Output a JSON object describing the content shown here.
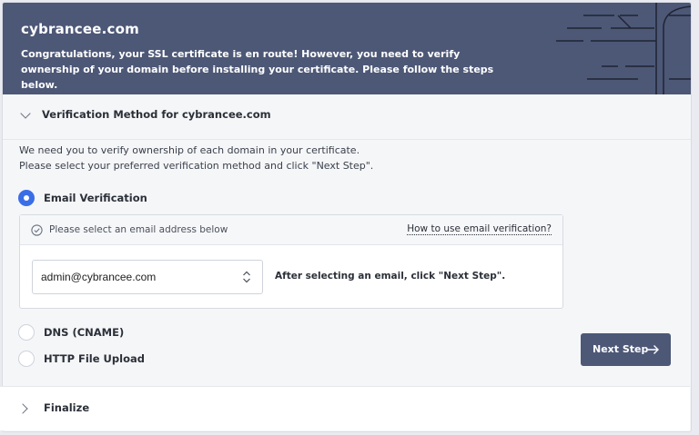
{
  "header": {
    "domain": "cybrancee.com",
    "message": "Congratulations, your SSL certificate is en route! However, you need to verify ownership of your domain before installing your certificate. Please follow the steps below."
  },
  "verification": {
    "section_title": "Verification Method for cybrancee.com",
    "intro_line1": "We need you to verify ownership of each domain in your certificate.",
    "intro_line2": "Please select your preferred verification method and click \"Next Step\".",
    "methods": [
      {
        "label": "Email Verification",
        "selected": true
      },
      {
        "label": "DNS (CNAME)",
        "selected": false
      },
      {
        "label": "HTTP File Upload",
        "selected": false
      }
    ],
    "email_panel": {
      "prompt": "Please select an email address below",
      "help_link": "How to use email verification?",
      "selected_email": "admin@cybrancee.com",
      "after_text": "After selecting an email, click \"Next Step\"."
    },
    "next_button": "Next Step"
  },
  "finalize": {
    "section_title": "Finalize"
  },
  "colors": {
    "header_bg": "#4d5877",
    "accent": "#3a6ee8",
    "button_bg": "#4d5877"
  }
}
